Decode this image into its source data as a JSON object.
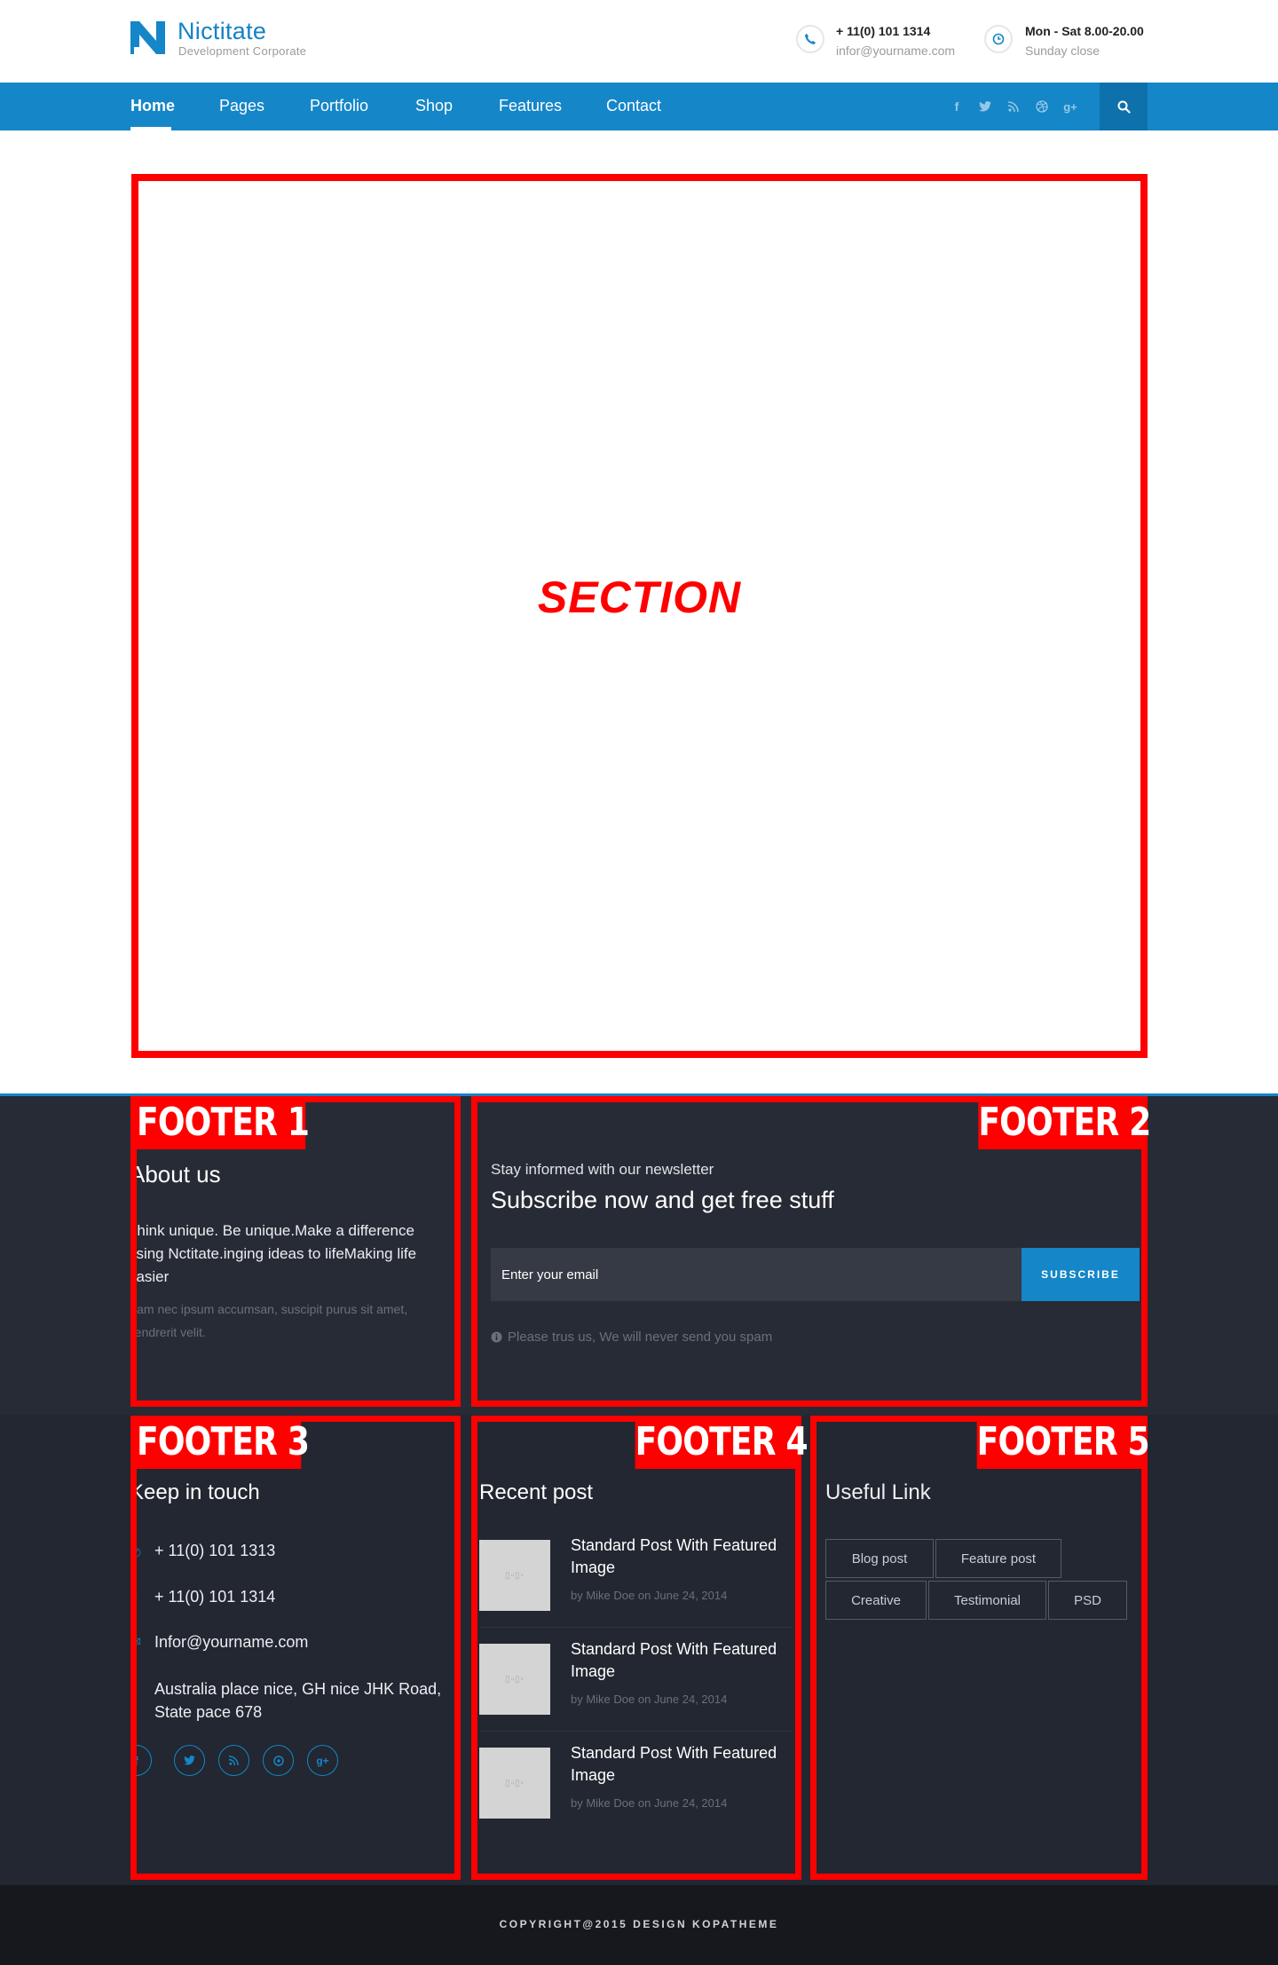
{
  "brand": {
    "title": "Nictitate",
    "subtitle": "Development Corporate",
    "accent_color": "#1586c8"
  },
  "contact": {
    "phone": "+ 11(0) 101 1314",
    "email": "infor@yourname.com",
    "hours": "Mon - Sat 8.00-20.00",
    "hours_note": "Sunday close",
    "phone_icon": "phone-icon",
    "clock_icon": "clock-icon"
  },
  "nav": {
    "items": [
      "Home",
      "Pages",
      "Portfolio",
      "Shop",
      "Features",
      "Contact"
    ],
    "active": "Home",
    "social_icons": [
      "facebook-icon",
      "twitter-icon",
      "rss-icon",
      "dribbble-icon",
      "google-plus-icon"
    ],
    "search_icon": "search-icon"
  },
  "section": {
    "label": "SECTION"
  },
  "footer1": {
    "tag": "FOOTER 1",
    "heading": "About us",
    "text": "Think unique. Be unique.Make a difference using Nctitate.inging ideas to lifeMaking life easier",
    "small": "Nam nec ipsum accumsan, suscipit purus sit amet, hendrerit velit."
  },
  "footer2": {
    "tag": "FOOTER 2",
    "kicker": "Stay informed with our newsletter",
    "heading": "Subscribe now and get free stuff",
    "email_placeholder": "Enter your email",
    "button": "SUBSCRIBE",
    "note": "Please trus us, We will never send you spam"
  },
  "footer3": {
    "tag": "FOOTER 3",
    "heading": "Keep in touch",
    "rows": [
      "+ 11(0) 101 1313",
      "+ 11(0) 101 1314",
      "Infor@yourname.com",
      "Australia place nice, GH nice JHK Road, State pace 678"
    ],
    "social_icons": [
      "facebook-icon",
      "twitter-icon",
      "rss-icon",
      "pinterest-icon",
      "google-plus-icon"
    ]
  },
  "footer4": {
    "tag": "FOOTER 4",
    "heading": "Recent post",
    "posts": [
      {
        "title": "Standard Post With Featured Image",
        "meta": "by Mike Doe on June 24, 2014"
      },
      {
        "title": "Standard Post With Featured Image",
        "meta": "by Mike Doe on June 24, 2014"
      },
      {
        "title": "Standard Post With Featured Image",
        "meta": "by Mike Doe on June 24, 2014"
      }
    ]
  },
  "footer5": {
    "tag": "FOOTER 5",
    "heading": "Useful Link",
    "tags": [
      "Blog post",
      "Feature post",
      "Creative",
      "Testimonial",
      "PSD"
    ]
  },
  "copyright": "COPYRIGHT@2015 DESIGN KOPATHEME"
}
